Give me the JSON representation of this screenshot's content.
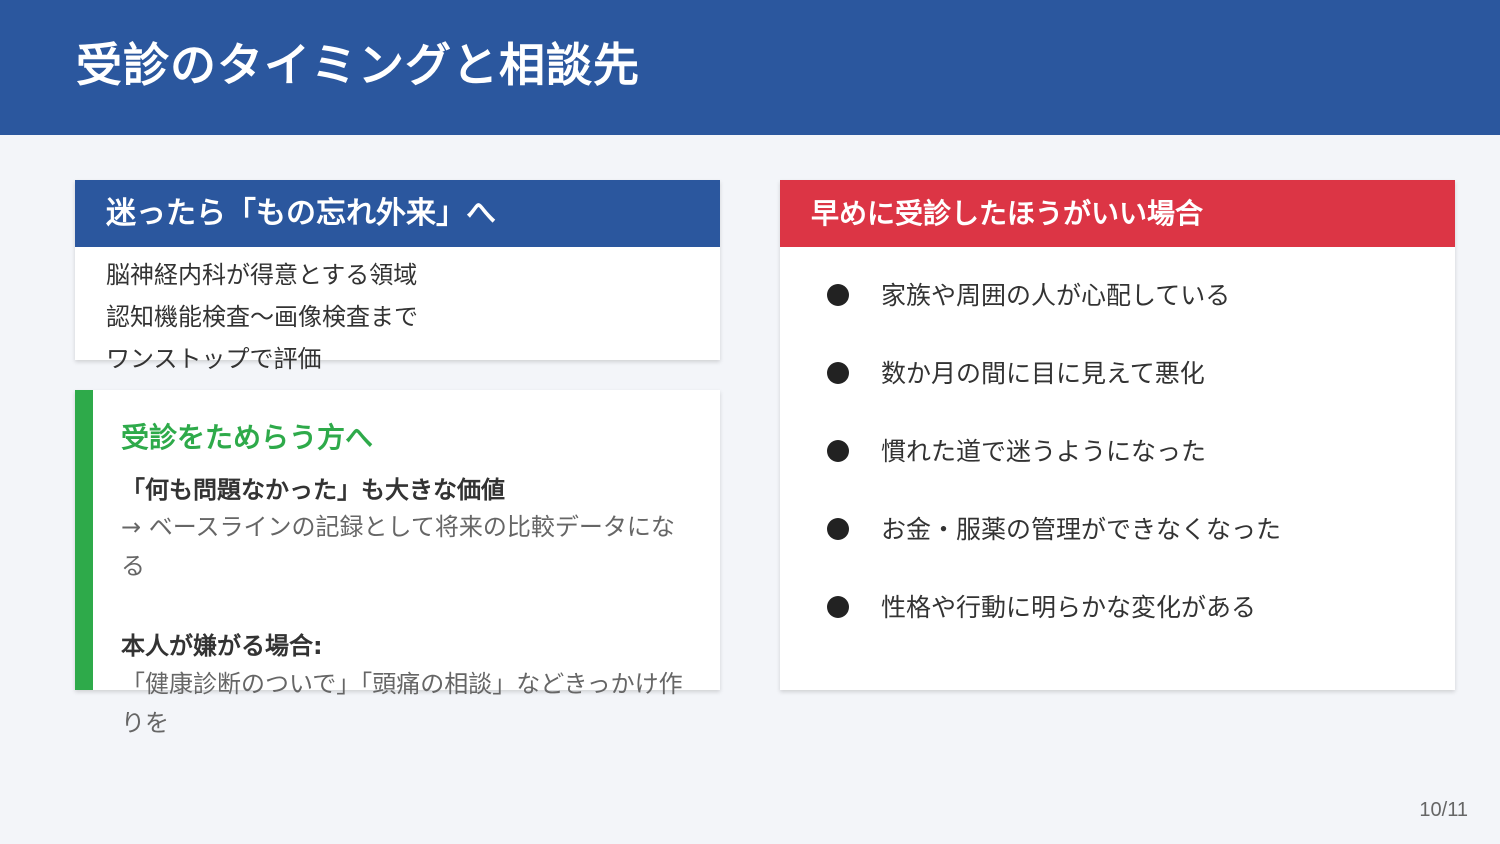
{
  "header": {
    "title": "受診のタイミングと相談先"
  },
  "card_a": {
    "title": "迷ったら「もの忘れ外来」へ",
    "lines": [
      "脳神経内科が得意とする領域",
      "認知機能検査〜画像検査まで",
      "ワンストップで評価"
    ]
  },
  "card_b": {
    "title": "受診をためらう方へ",
    "strong1": "「何も問題なかった」も大きな価値",
    "desc1": "→ ベースラインの記録として将来の比較データになる",
    "strong2": "本人が嫌がる場合:",
    "desc2": "「健康診断のついで」「頭痛の相談」などきっかけ作りを"
  },
  "card_c": {
    "title": "早めに受診したほうがいい場合",
    "items": [
      "家族や周囲の人が心配している",
      "数か月の間に目に見えて悪化",
      "慣れた道で迷うようになった",
      "お金・服薬の管理ができなくなった",
      "性格や行動に明らかな変化がある"
    ]
  },
  "footer": {
    "page": "10/11"
  },
  "colors": {
    "header": "#2b579e",
    "accent_green": "#2eaa4a",
    "accent_red": "#dc3545"
  }
}
